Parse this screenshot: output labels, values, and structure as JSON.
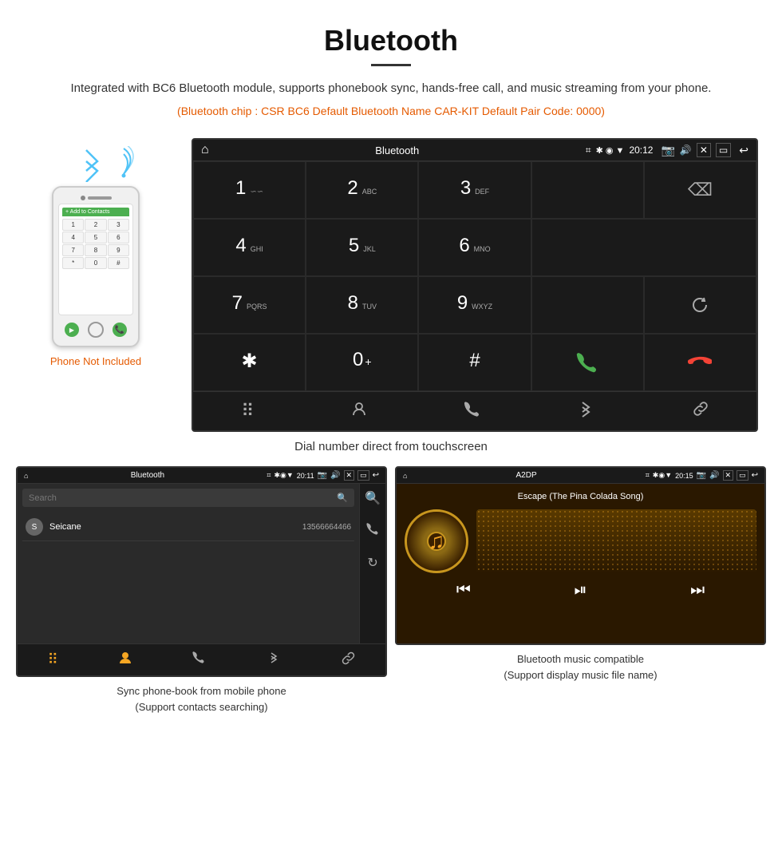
{
  "header": {
    "title": "Bluetooth",
    "description": "Integrated with BC6 Bluetooth module, supports phonebook sync, hands-free call, and music streaming from your phone.",
    "info_line": "(Bluetooth chip : CSR BC6    Default Bluetooth Name CAR-KIT    Default Pair Code: 0000)"
  },
  "phone_note": "Phone Not Included",
  "device": {
    "status_bar": {
      "title": "Bluetooth",
      "time": "20:12"
    },
    "dialpad": {
      "keys": [
        {
          "num": "1",
          "sub": ""
        },
        {
          "num": "2",
          "sub": "ABC"
        },
        {
          "num": "3",
          "sub": "DEF"
        },
        {
          "num": "4",
          "sub": "GHI"
        },
        {
          "num": "5",
          "sub": "JKL"
        },
        {
          "num": "6",
          "sub": "MNO"
        },
        {
          "num": "7",
          "sub": "PQRS"
        },
        {
          "num": "8",
          "sub": "TUV"
        },
        {
          "num": "9",
          "sub": "WXYZ"
        },
        {
          "num": "*",
          "sub": ""
        },
        {
          "num": "0",
          "sub": "+"
        },
        {
          "num": "#",
          "sub": ""
        }
      ]
    }
  },
  "caption_main": "Dial number direct from touchscreen",
  "phonebook": {
    "status_bar": {
      "title": "Bluetooth",
      "time": "20:11"
    },
    "search_placeholder": "Search",
    "contacts": [
      {
        "initial": "S",
        "name": "Seicane",
        "number": "13566664466"
      }
    ],
    "caption": "Sync phone-book from mobile phone\n(Support contacts searching)"
  },
  "music": {
    "status_bar": {
      "title": "A2DP",
      "time": "20:15"
    },
    "song_title": "Escape (The Pina Colada Song)",
    "caption": "Bluetooth music compatible\n(Support display music file name)"
  }
}
